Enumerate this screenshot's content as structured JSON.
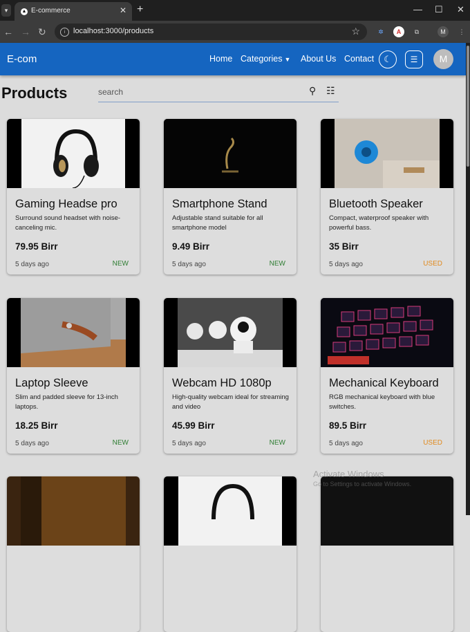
{
  "browser": {
    "tab_title": "E-commerce",
    "url": "localhost:3000/products",
    "profile_initial": "M"
  },
  "navbar": {
    "brand": "E-com",
    "links": [
      "Home",
      "Categories",
      "About Us",
      "Contact"
    ],
    "avatar_initial": "M",
    "color": "#1565c0"
  },
  "page": {
    "title": "Products",
    "search_placeholder": "search"
  },
  "products": [
    {
      "title": "Gaming Headse pro",
      "description": "Surround sound headset with noise-canceling mic.",
      "price": "79.95 Birr",
      "time": "5 days ago",
      "condition": "NEW"
    },
    {
      "title": "Smartphone Stand",
      "description": "Adjustable stand suitable for all smartphone model",
      "price": "9.49 Birr",
      "time": "5 days ago",
      "condition": "NEW"
    },
    {
      "title": "Bluetooth Speaker",
      "description": "Compact, waterproof speaker with powerful bass.",
      "price": "35 Birr",
      "time": "5 days ago",
      "condition": "USED"
    },
    {
      "title": "Laptop Sleeve",
      "description": "Slim and padded sleeve for 13-inch laptops.",
      "price": "18.25 Birr",
      "time": "5 days ago",
      "condition": "NEW"
    },
    {
      "title": "Webcam HD 1080p",
      "description": "High-quality webcam ideal for streaming and video",
      "price": "45.99 Birr",
      "time": "5 days ago",
      "condition": "NEW"
    },
    {
      "title": "Mechanical Keyboard",
      "description": "RGB mechanical keyboard with blue switches.",
      "price": "89.5 Birr",
      "time": "5 days ago",
      "condition": "USED"
    }
  ],
  "colors": {
    "new": "#2e7d32",
    "used": "#e08a1e"
  },
  "overlay": {
    "watermark": "Activate Windows",
    "watermark_sub": "Go to Settings to activate Windows."
  }
}
